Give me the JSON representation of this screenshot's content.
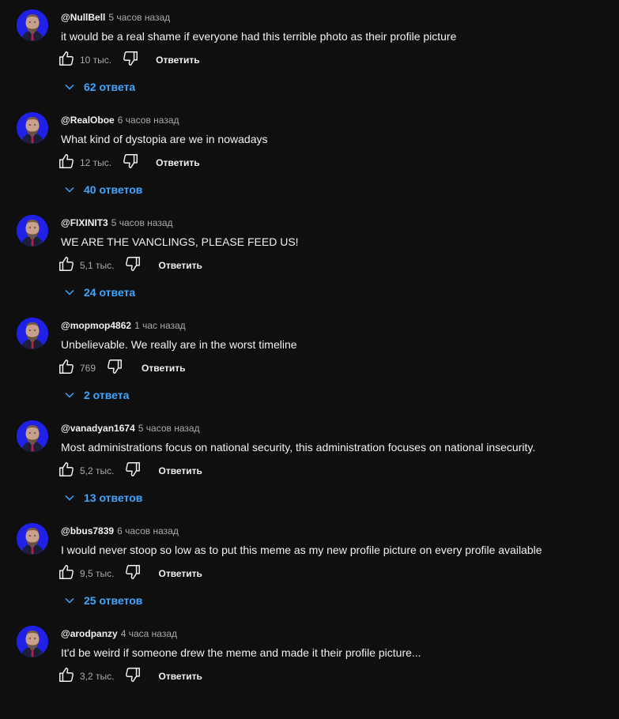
{
  "colors": {
    "background": "#0f0f0f",
    "text": "#f1f1f1",
    "secondary_text": "#aaaaaa",
    "link_blue": "#3ea6ff",
    "avatar_blue": "#1f22e6"
  },
  "icons": {
    "like": "thumb-up-icon",
    "dislike": "thumb-down-icon",
    "expand": "chevron-down-icon"
  },
  "reply_label": "Ответить",
  "comments": [
    {
      "author": "@NullBell",
      "time": "5 часов назад",
      "text": "it would be a real shame if everyone had this terrible photo as their profile picture",
      "likes": "10 тыс.",
      "replies": "62 ответа"
    },
    {
      "author": "@RealOboe",
      "time": "6 часов назад",
      "text": "What kind of dystopia are we in nowadays",
      "likes": "12 тыс.",
      "replies": "40 ответов"
    },
    {
      "author": "@FIXINIT3",
      "time": "5 часов назад",
      "text": "WE ARE THE VANCLINGS, PLEASE FEED US!",
      "likes": "5,1 тыс.",
      "replies": "24 ответа"
    },
    {
      "author": "@mopmop4862",
      "time": "1 час назад",
      "text": "Unbelievable. We really are in the worst timeline",
      "likes": "769",
      "replies": "2 ответа"
    },
    {
      "author": "@vanadyan1674",
      "time": "5 часов назад",
      "text": "Most administrations focus on national security, this administration focuses on national insecurity.",
      "likes": "5,2 тыс.",
      "replies": "13 ответов"
    },
    {
      "author": "@bbus7839",
      "time": "6 часов назад",
      "text": "I would never stoop so low as to put this meme as my new profile picture on every profile available",
      "likes": "9,5 тыс.",
      "replies": "25 ответов"
    },
    {
      "author": "@arodpanzy",
      "time": "4 часа назад",
      "text": "It'd be weird if someone drew the meme and made it their profile picture...",
      "likes": "3,2 тыс.",
      "replies": ""
    }
  ]
}
